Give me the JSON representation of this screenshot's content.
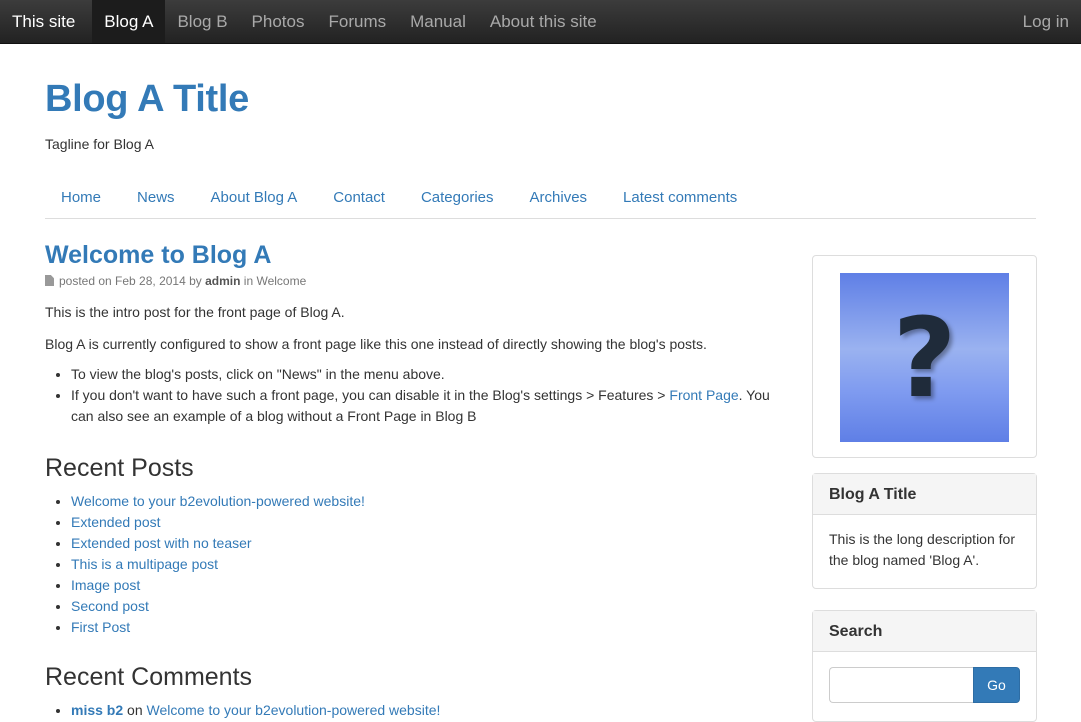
{
  "topnav": {
    "brand": "This site",
    "items": [
      "Blog A",
      "Blog B",
      "Photos",
      "Forums",
      "Manual",
      "About this site"
    ],
    "active_index": 0,
    "login": "Log in"
  },
  "header": {
    "title": "Blog A Title",
    "tagline": "Tagline for Blog A"
  },
  "blog_menu": [
    "Home",
    "News",
    "About Blog A",
    "Contact",
    "Categories",
    "Archives",
    "Latest comments"
  ],
  "post": {
    "title": "Welcome to Blog A",
    "meta_prefix": "posted on Feb 28, 2014 by ",
    "meta_author": "admin",
    "meta_in": " in ",
    "meta_category": "Welcome",
    "p1": "This is the intro post for the front page of Blog A.",
    "p2": "Blog A is currently configured to show a front page like this one instead of directly showing the blog's posts.",
    "bullet1": "To view the blog's posts, click on \"News\" in the menu above.",
    "bullet2_a": "If you don't want to have such a front page, you can disable it in the Blog's settings > Features > ",
    "bullet2_link": "Front Page",
    "bullet2_b": ". You can also see an example of a blog without a Front Page in Blog B"
  },
  "recent_posts": {
    "heading": "Recent Posts",
    "items": [
      "Welcome to your b2evolution-powered website!",
      "Extended post",
      "Extended post with no teaser",
      "This is a multipage post",
      "Image post",
      "Second post",
      "First Post"
    ]
  },
  "recent_comments": {
    "heading": "Recent Comments",
    "items": [
      {
        "author": "miss b2",
        "on": " on ",
        "post": "Welcome to your b2evolution-powered website!"
      }
    ]
  },
  "sidebar": {
    "image_icon": "question-mark-icon",
    "about_title": "Blog A Title",
    "about_text": "This is the long description for the blog named 'Blog A'.",
    "search_title": "Search",
    "search_value": "",
    "search_button": "Go"
  },
  "colors": {
    "link": "#337ab7",
    "topbar": "#2b2b2b"
  }
}
